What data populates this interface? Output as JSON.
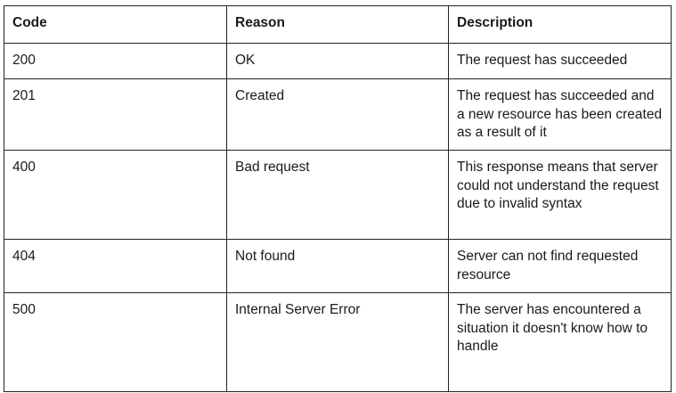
{
  "table": {
    "headers": [
      "Code",
      "Reason",
      "Description"
    ],
    "rows": [
      {
        "code": "200",
        "reason": "OK",
        "description": "The request has succeeded"
      },
      {
        "code": "201",
        "reason": "Created",
        "description": "The request has succeeded and a new resource has been created as a result of it"
      },
      {
        "code": "400",
        "reason": "Bad request",
        "description": "This response means that server could not understand the request due to invalid syntax"
      },
      {
        "code": "404",
        "reason": "Not found",
        "description": "Server can not find requested resource"
      },
      {
        "code": "500",
        "reason": "Internal Server Error",
        "description": "The server has encountered a situation it doesn't know how to handle"
      }
    ]
  }
}
